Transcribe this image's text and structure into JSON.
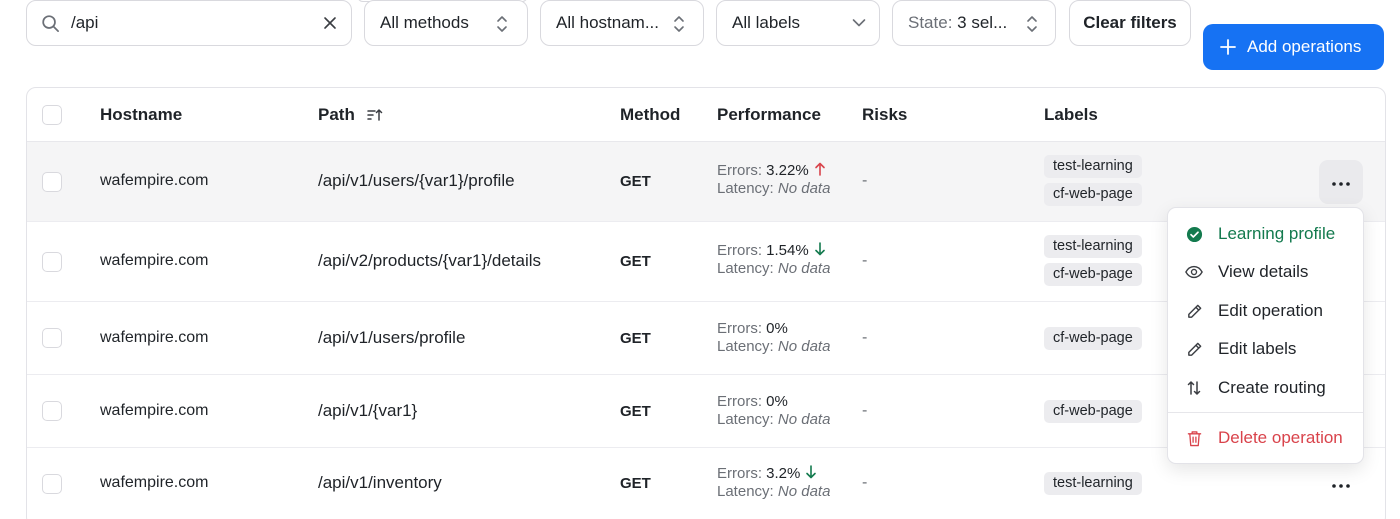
{
  "filters": {
    "search_value": "/api",
    "methods_label": "All methods",
    "hostnames_label": "All hostnam...",
    "labels_label": "All labels",
    "state_prefix": "State:",
    "state_value": "3 sel...",
    "clear_label": "Clear filters",
    "add_label": "Add operations"
  },
  "table": {
    "headers": {
      "hostname": "Hostname",
      "path": "Path",
      "method": "Method",
      "performance": "Performance",
      "risks": "Risks",
      "labels": "Labels"
    },
    "errors_prefix": "Errors:",
    "latency_prefix": "Latency:",
    "rows": [
      {
        "hostname": "wafempire.com",
        "path": "/api/v1/users/{var1}/profile",
        "method": "GET",
        "errors": "3.22%",
        "trend": "up",
        "latency": "No data",
        "risks": "-",
        "labels": [
          "test-learning",
          "cf-web-page"
        ]
      },
      {
        "hostname": "wafempire.com",
        "path": "/api/v2/products/{var1}/details",
        "method": "GET",
        "errors": "1.54%",
        "trend": "down",
        "latency": "No data",
        "risks": "-",
        "labels": [
          "test-learning",
          "cf-web-page"
        ]
      },
      {
        "hostname": "wafempire.com",
        "path": "/api/v1/users/profile",
        "method": "GET",
        "errors": "0%",
        "trend": "none",
        "latency": "No data",
        "risks": "-",
        "labels": [
          "cf-web-page"
        ]
      },
      {
        "hostname": "wafempire.com",
        "path": "/api/v1/{var1}",
        "method": "GET",
        "errors": "0%",
        "trend": "none",
        "latency": "No data",
        "risks": "-",
        "labels": [
          "cf-web-page"
        ]
      },
      {
        "hostname": "wafempire.com",
        "path": "/api/v1/inventory",
        "method": "GET",
        "errors": "3.2%",
        "trend": "down",
        "latency": "No data",
        "risks": "-",
        "labels": [
          "test-learning"
        ]
      }
    ]
  },
  "menu": {
    "items": [
      {
        "label": "Learning profile",
        "icon": "check-circle-icon"
      },
      {
        "label": "View details",
        "icon": "eye-icon"
      },
      {
        "label": "Edit operation",
        "icon": "pencil-icon"
      },
      {
        "label": "Edit labels",
        "icon": "pencil-icon"
      },
      {
        "label": "Create routing",
        "icon": "arrows-up-down-icon"
      },
      {
        "label": "Delete operation",
        "icon": "trash-icon"
      }
    ]
  },
  "colors": {
    "accent": "#1672f3",
    "success": "#137a4e",
    "danger": "#d9434b",
    "trend_up": "#d9434b",
    "trend_down": "#137a4e"
  }
}
